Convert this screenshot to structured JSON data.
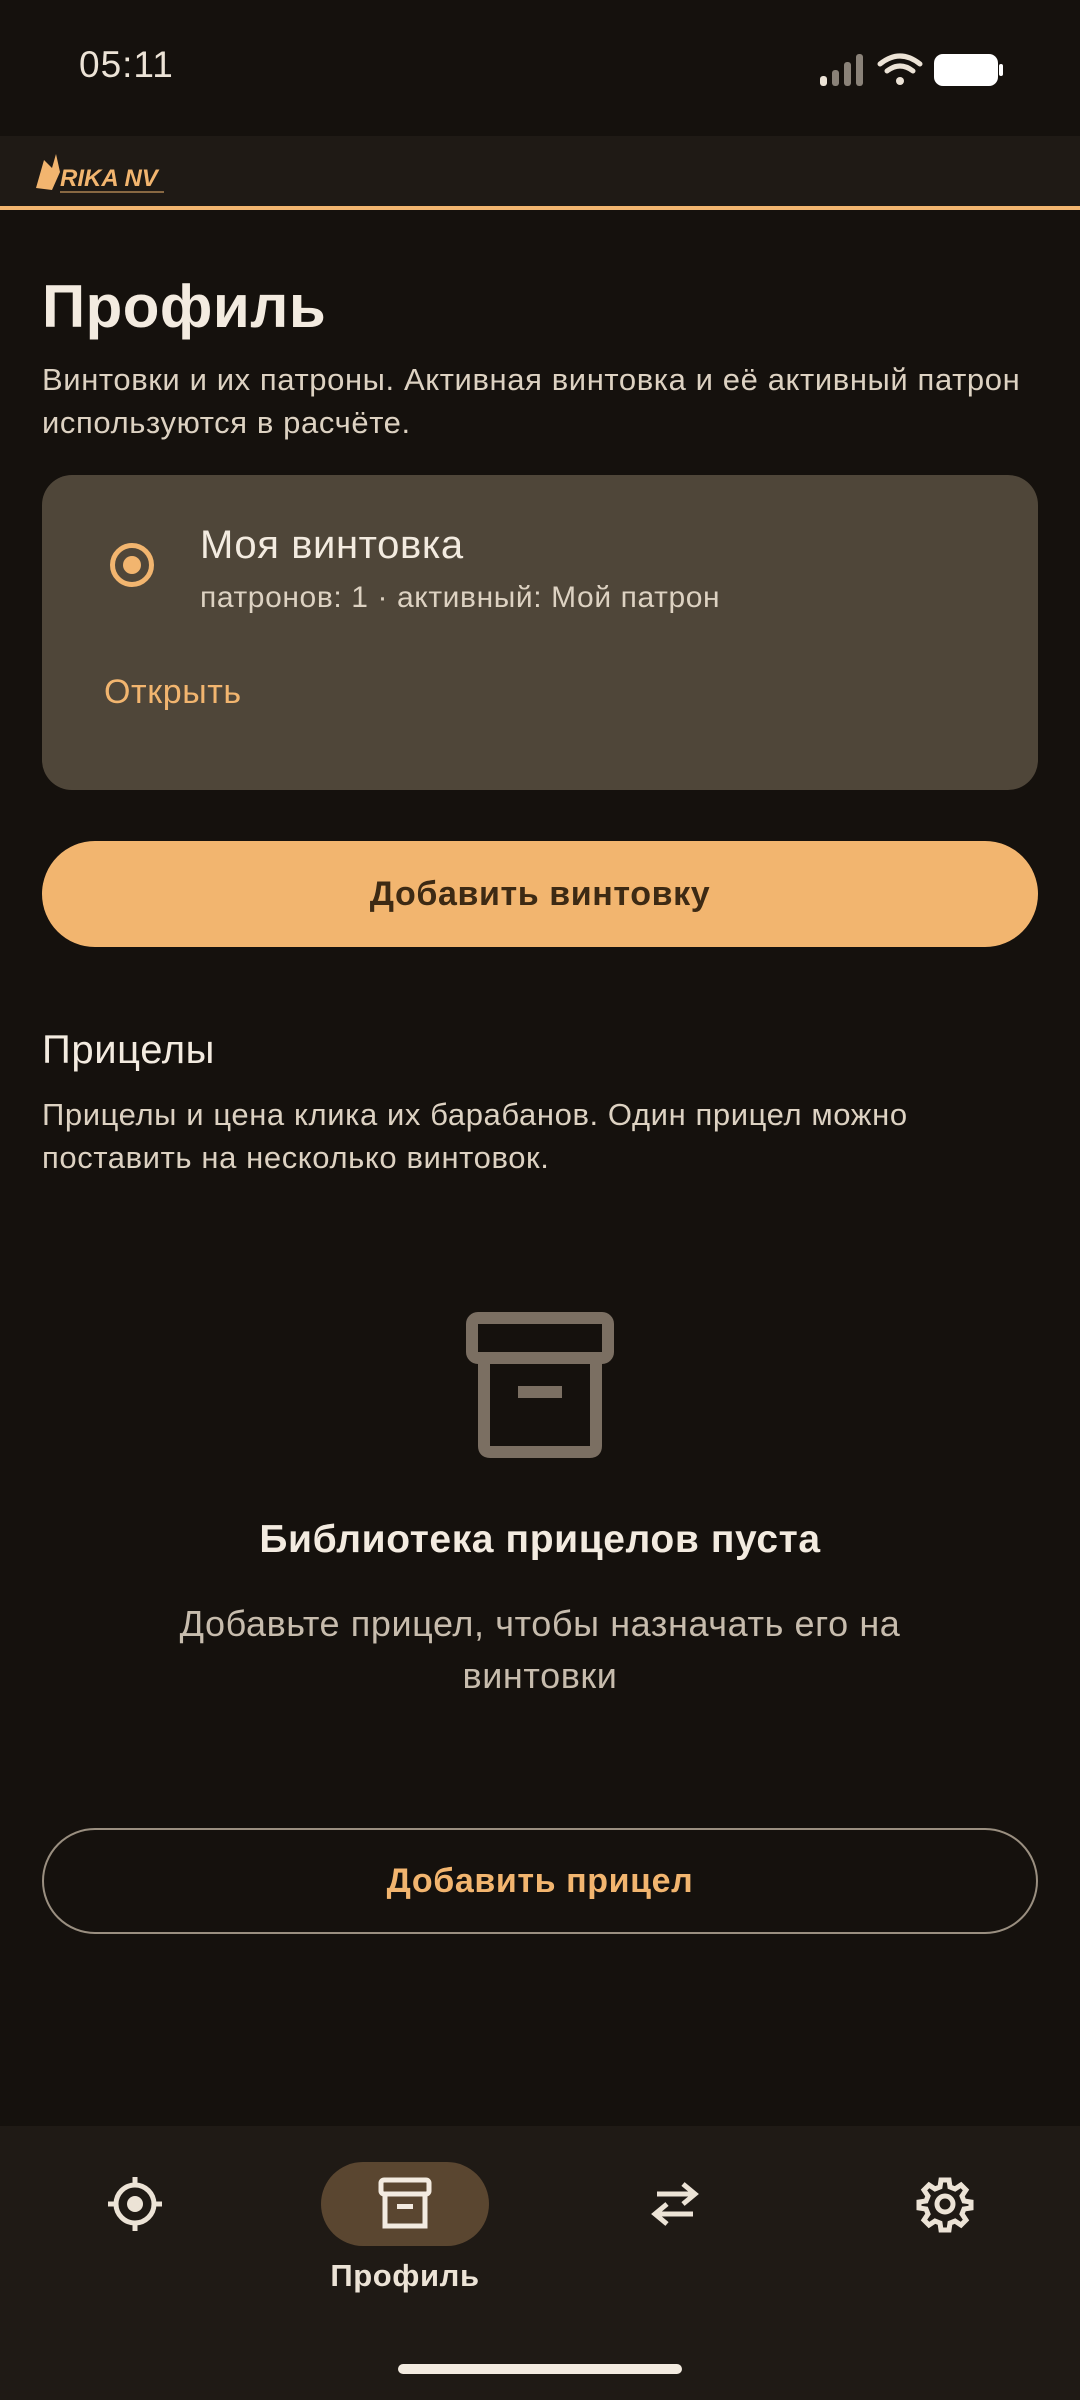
{
  "status_bar": {
    "time": "05:11",
    "icons": [
      "signal-icon",
      "wifi-icon",
      "battery-icon"
    ]
  },
  "app_bar": {
    "logo_text": "RIKA NV",
    "accent_color": "#f2b56f"
  },
  "page": {
    "title": "Профиль",
    "subtitle": "Винтовки и их патроны. Активная винтовка и её активный патрон используются в расчёте."
  },
  "rifles": [
    {
      "name": "Моя винтовка",
      "meta": "патронов: 1 · активный: Мой патрон",
      "selected": true,
      "open_label": "Открыть"
    }
  ],
  "add_rifle_label": "Добавить винтовку",
  "scopes": {
    "title": "Прицелы",
    "subtitle": "Прицелы и цена клика их барабанов. Один прицел можно поставить на несколько винтовок.",
    "empty_icon": "archive-box-icon",
    "empty_title": "Библиотека прицелов пуста",
    "empty_text": "Добавьте прицел, чтобы назначать его на винтовки",
    "add_label": "Добавить прицел"
  },
  "bottom_nav": [
    {
      "icon": "crosshair-icon",
      "label": "",
      "active": false
    },
    {
      "icon": "archive-icon",
      "label": "Профиль",
      "active": true
    },
    {
      "icon": "swap-arrows-icon",
      "label": "",
      "active": false
    },
    {
      "icon": "gear-icon",
      "label": "",
      "active": false
    }
  ]
}
